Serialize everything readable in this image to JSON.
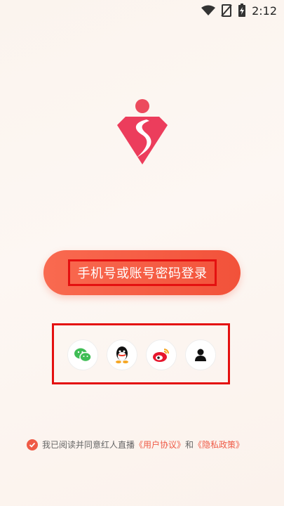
{
  "status_bar": {
    "time": "2:12",
    "icons": [
      "wifi-icon",
      "no-sim-icon",
      "battery-charging-icon"
    ]
  },
  "logo": {
    "name": "diamond-logo-icon"
  },
  "login_button": {
    "label": "手机号或账号密码登录"
  },
  "social_login": [
    {
      "name": "wechat-icon"
    },
    {
      "name": "qq-icon"
    },
    {
      "name": "weibo-icon"
    },
    {
      "name": "user-icon"
    }
  ],
  "agreement": {
    "prefix": "我已阅读并同意红人直播",
    "user_agreement": "《用户协议》",
    "and": "和",
    "privacy_policy": "《隐私政策》"
  },
  "colors": {
    "accent": "#f2523a",
    "highlight_box": "#e41010"
  }
}
